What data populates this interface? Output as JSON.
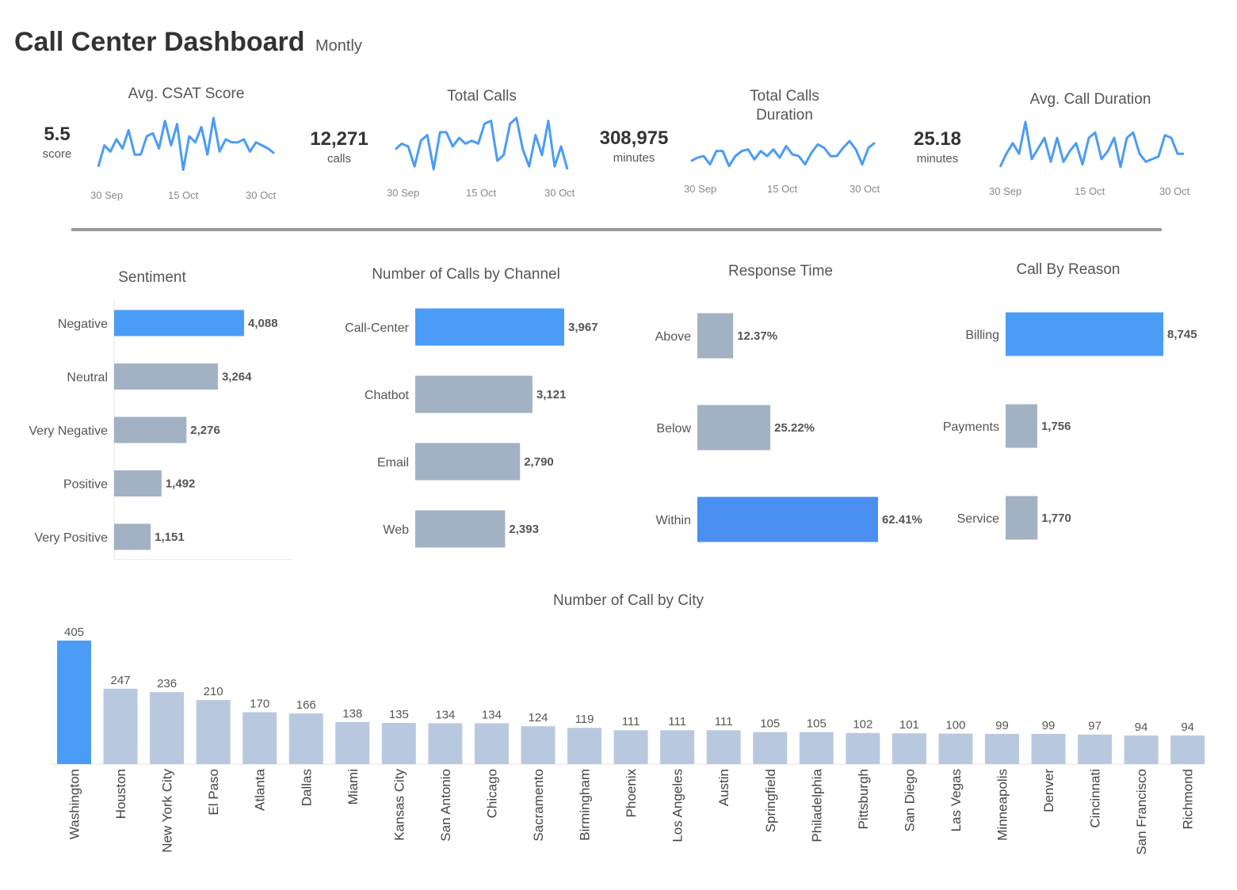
{
  "header": {
    "title": "Call Center Dashboard",
    "subtitle": "Montly"
  },
  "colors": {
    "highlight": "#4a9cf6",
    "bar": "#a3b1c4",
    "city_bar": "#b8c9df",
    "line": "#4a9cf6"
  },
  "kpis": [
    {
      "title": "Avg. CSAT Score",
      "value": "5.5",
      "unit": "score",
      "ticks": [
        "30 Sep",
        "15 Oct",
        "30 Oct"
      ],
      "series": [
        0.8,
        0.45,
        0.55,
        0.35,
        0.5,
        0.2,
        0.6,
        0.6,
        0.3,
        0.25,
        0.5,
        0.05,
        0.45,
        0.1,
        0.85,
        0.3,
        0.4,
        0.15,
        0.6,
        0.0,
        0.55,
        0.35,
        0.4,
        0.4,
        0.35,
        0.55,
        0.4,
        0.45,
        0.5,
        0.58
      ]
    },
    {
      "title": "Total Calls",
      "value": "12,271",
      "unit": "calls",
      "ticks": [
        "30 Sep",
        "15 Oct",
        "30 Oct"
      ],
      "series": [
        0.55,
        0.45,
        0.5,
        0.85,
        0.4,
        0.3,
        0.9,
        0.25,
        0.25,
        0.5,
        0.35,
        0.45,
        0.4,
        0.45,
        0.1,
        0.05,
        0.75,
        0.65,
        0.1,
        0.0,
        0.55,
        0.85,
        0.3,
        0.65,
        0.05,
        0.85,
        0.5,
        0.9
      ]
    },
    {
      "title": "Total Calls\nDuration",
      "value": "308,975",
      "unit": "minutes",
      "ticks": [
        "30 Sep",
        "15 Oct",
        "30 Oct"
      ],
      "series": [
        0.7,
        0.6,
        0.55,
        0.8,
        0.4,
        0.4,
        0.85,
        0.55,
        0.4,
        0.35,
        0.65,
        0.4,
        0.55,
        0.35,
        0.6,
        0.25,
        0.5,
        0.55,
        0.8,
        0.45,
        0.2,
        0.3,
        0.55,
        0.55,
        0.3,
        0.1,
        0.35,
        0.8,
        0.3,
        0.15
      ]
    },
    {
      "title": "Avg. Call Duration",
      "value": "25.18",
      "unit": "minutes",
      "ticks": [
        "30 Sep",
        "15 Oct",
        "30 Oct"
      ],
      "series": [
        0.85,
        0.6,
        0.4,
        0.6,
        0.0,
        0.7,
        0.5,
        0.3,
        0.75,
        0.3,
        0.75,
        0.55,
        0.4,
        0.8,
        0.3,
        0.2,
        0.7,
        0.55,
        0.3,
        0.85,
        0.3,
        0.2,
        0.6,
        0.75,
        0.7,
        0.65,
        0.25,
        0.3,
        0.6,
        0.6
      ]
    }
  ],
  "chart_data": [
    {
      "type": "bar",
      "title": "Sentiment",
      "orientation": "horizontal",
      "categories": [
        "Negative",
        "Neutral",
        "Very Negative",
        "Positive",
        "Very Positive"
      ],
      "values": [
        4088,
        3264,
        2276,
        1492,
        1151
      ],
      "labels": [
        "4,088",
        "3,264",
        "2,276",
        "1,492",
        "1,151"
      ]
    },
    {
      "type": "bar",
      "title": "Number of Calls by Channel",
      "orientation": "horizontal",
      "categories": [
        "Call-Center",
        "Chatbot",
        "Email",
        "Web"
      ],
      "values": [
        3967,
        3121,
        2790,
        2393
      ],
      "labels": [
        "3,967",
        "3,121",
        "2,790",
        "2,393"
      ]
    },
    {
      "type": "bar",
      "title": "Response Time",
      "orientation": "horizontal",
      "categories": [
        "Above",
        "Below",
        "Within"
      ],
      "values": [
        12.37,
        25.22,
        62.41
      ],
      "labels": [
        "12.37%",
        "25.22%",
        "62.41%"
      ]
    },
    {
      "type": "bar",
      "title": "Call By Reason",
      "orientation": "horizontal",
      "categories": [
        "Billing",
        "Payments",
        "Service"
      ],
      "values": [
        8745,
        1756,
        1770
      ],
      "labels": [
        "8,745",
        "1,756",
        "1,770"
      ]
    },
    {
      "type": "bar",
      "title": "Number of Call by City",
      "orientation": "vertical",
      "categories": [
        "Washington",
        "Houston",
        "New York City",
        "El Paso",
        "Atlanta",
        "Dallas",
        "Miami",
        "Kansas City",
        "San Antonio",
        "Chicago",
        "Sacramento",
        "Birmingham",
        "Phoenix",
        "Los Angeles",
        "Austin",
        "Springfield",
        "Philadelphia",
        "Pittsburgh",
        "San Diego",
        "Las Vegas",
        "Minneapolis",
        "Denver",
        "Cincinnati",
        "San Francisco",
        "Richmond"
      ],
      "values": [
        405,
        247,
        236,
        210,
        170,
        166,
        138,
        135,
        134,
        134,
        124,
        119,
        111,
        111,
        111,
        105,
        105,
        102,
        101,
        100,
        99,
        99,
        97,
        94,
        94
      ]
    }
  ]
}
